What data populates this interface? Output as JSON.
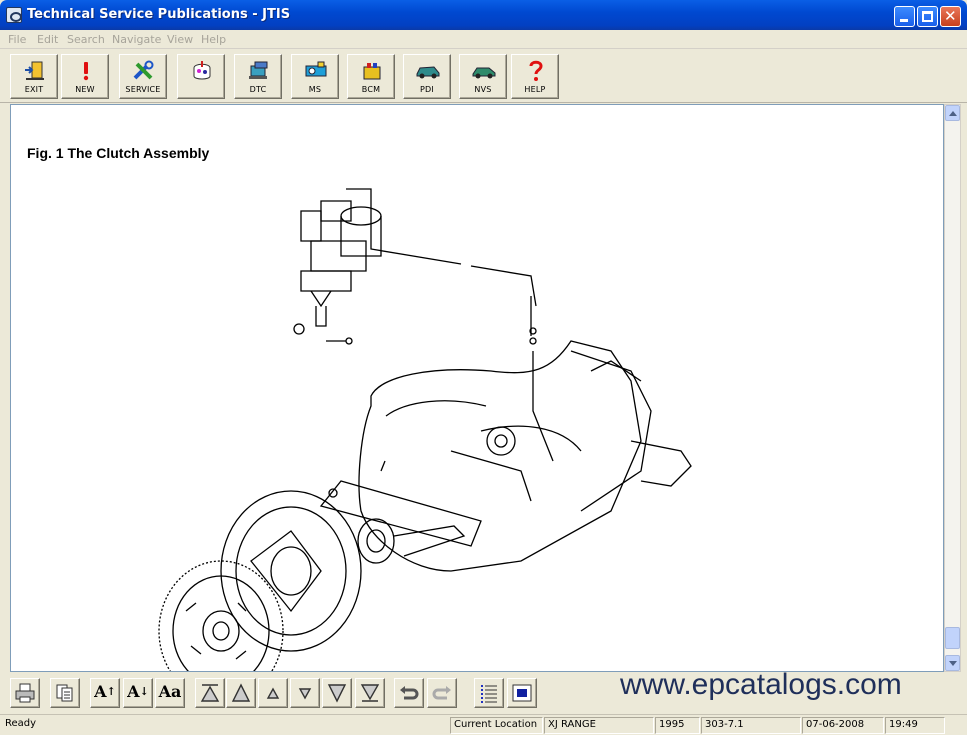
{
  "window": {
    "title": "Technical Service Publications - JTIS",
    "close_glyph": "✕"
  },
  "menu": [
    "File",
    "Edit",
    "Search",
    "Navigate",
    "View",
    "Help"
  ],
  "toolbar": [
    {
      "label": "EXIT",
      "icon": "exit-door-icon"
    },
    {
      "label": "NEW",
      "icon": "exclamation-icon"
    },
    {
      "label": "SERVICE",
      "icon": "wrench-icon"
    },
    {
      "label": "",
      "icon": "diagnostic-icon"
    },
    {
      "label": "DTC",
      "icon": "dtc-icon"
    },
    {
      "label": "MS",
      "icon": "ms-icon"
    },
    {
      "label": "BCM",
      "icon": "bcm-icon"
    },
    {
      "label": "PDI",
      "icon": "pdi-car-icon"
    },
    {
      "label": "NVS",
      "icon": "nvs-car-icon"
    },
    {
      "label": "HELP",
      "icon": "question-icon"
    }
  ],
  "document": {
    "figure_title": "Fig. 1 The Clutch Assembly"
  },
  "bottom_toolbar": {
    "font_increase": "A",
    "font_decrease": "A",
    "font_case": "Aa"
  },
  "watermark": "www.epcatalogs.com",
  "status": {
    "ready": "Ready",
    "location_label": "Current Location",
    "model": "XJ RANGE",
    "year": "1995",
    "section": "303-7.1",
    "date": "07-06-2008",
    "time": "19:49"
  },
  "colors": {
    "titlebar": "#0049d1",
    "window_bg": "#ece9d8",
    "watermark": "#1f2f5a"
  }
}
